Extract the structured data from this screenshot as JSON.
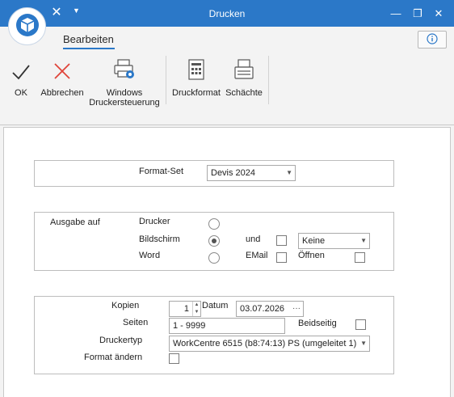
{
  "window": {
    "title": "Drucken",
    "minimize": "—",
    "maximize": "❐",
    "close": "✕",
    "quick_close": "✕",
    "quick_dropdown": "▼"
  },
  "ribbon": {
    "tab": "Bearbeiten",
    "info": "i",
    "buttons": {
      "ok": "OK",
      "cancel": "Abbrechen",
      "printer_control_line1": "Windows",
      "printer_control_line2": "Druckersteuerung",
      "print_format": "Druckformat",
      "trays": "Schächte"
    }
  },
  "format_set": {
    "label": "Format-Set",
    "value": "Devis 2024"
  },
  "output": {
    "label": "Ausgabe auf",
    "printer": "Drucker",
    "screen": "Bildschirm",
    "word": "Word",
    "and": "und",
    "email": "EMail",
    "open": "Öffnen",
    "combo_value": "Keine",
    "selected": "Bildschirm"
  },
  "print": {
    "copies_label": "Kopien",
    "copies_value": "1",
    "date_label": "Datum",
    "date_value": "03.07.2026",
    "pages_label": "Seiten",
    "pages_value": "1 - 9999",
    "duplex_label": "Beidseitig",
    "printer_type_label": "Druckertyp",
    "printer_type_value": "WorkCentre 6515 (b8:74:13) PS (umgeleitet 1)",
    "change_format_label": "Format ändern"
  },
  "colors": {
    "titlebar": "#2b78c8",
    "ok_check": "#333333",
    "cancel_x": "#e0443a"
  }
}
